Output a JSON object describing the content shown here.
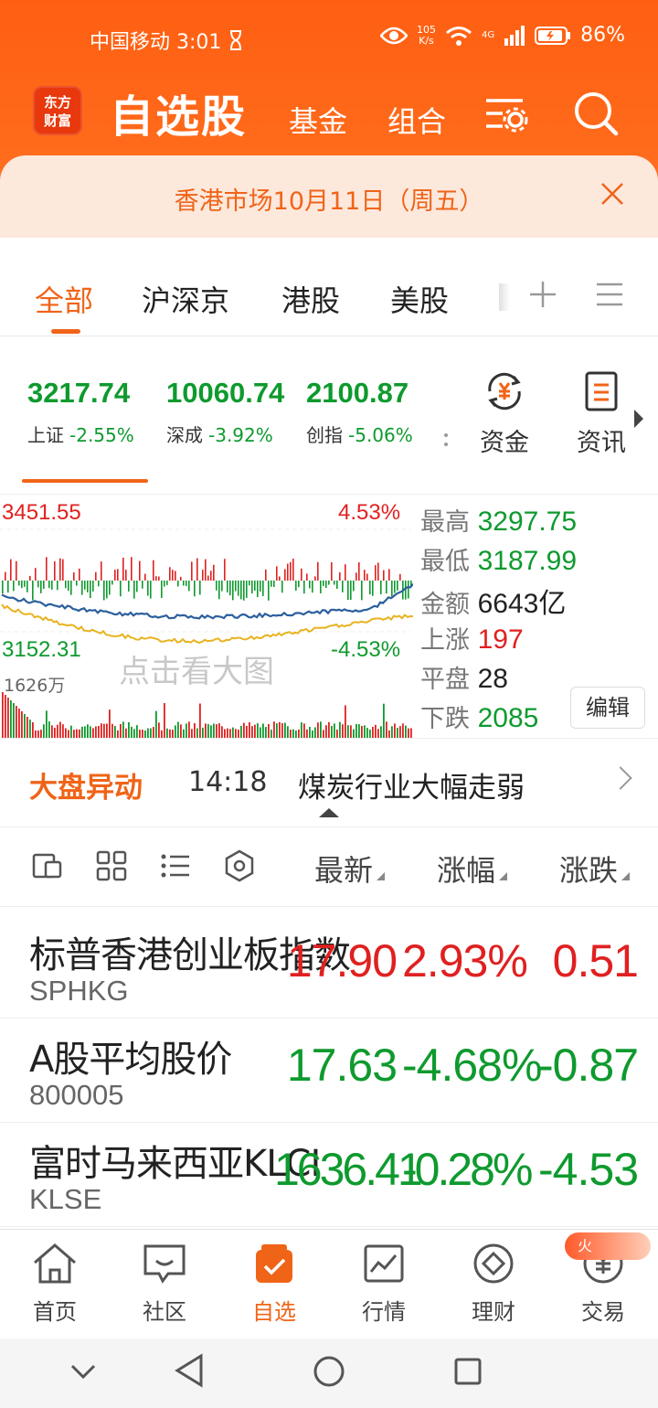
{
  "status_bar": {
    "carrier_time": "中国移动 3:01",
    "net_speed_top": "105",
    "net_speed_unit": "K/s",
    "signal_label": "4G",
    "battery": "86%"
  },
  "app_bar": {
    "logo_line1": "东方",
    "logo_line2": "财富",
    "title": "自选股",
    "tab_fund": "基金",
    "tab_combo": "组合"
  },
  "banner": {
    "text": "香港市场10月11日（周五）"
  },
  "tabs": [
    {
      "label": "全部"
    },
    {
      "label": "沪深京"
    },
    {
      "label": "港股"
    },
    {
      "label": "美股"
    }
  ],
  "indices": [
    {
      "value": "3217.74",
      "name": "上证",
      "change": "-2.55%"
    },
    {
      "value": "10060.74",
      "name": "深成",
      "change": "-3.92%"
    },
    {
      "value": "2100.87",
      "name": "创指",
      "change": "-5.06%"
    }
  ],
  "quick_links": [
    {
      "label": "资金",
      "icon": "yuan-cycle-icon"
    },
    {
      "label": "资讯",
      "icon": "document-icon"
    }
  ],
  "mini_chart": {
    "high_price": "3451.55",
    "high_pct": "4.53%",
    "low_price": "3152.31",
    "low_pct": "-4.53%",
    "volume": "1626万",
    "watermark": "点击看大图",
    "colors": {
      "up": "#e02020",
      "down": "#0e9a2e",
      "line_blue": "#2c5f9e",
      "line_yellow": "#e8b320"
    }
  },
  "market_stats": {
    "high_label": "最高",
    "high_value": "3297.75",
    "low_label": "最低",
    "low_value": "3187.99",
    "amount_label": "金额",
    "amount_value": "6643亿",
    "up_label": "上涨",
    "up_value": "197",
    "flat_label": "平盘",
    "flat_value": "28",
    "down_label": "下跌",
    "down_value": "2085",
    "edit_label": "编辑"
  },
  "market_alert": {
    "title": "大盘异动",
    "time": "14:18",
    "text": "煤炭行业大幅走弱"
  },
  "list_header": {
    "col_latest": "最新",
    "col_pct": "涨幅",
    "col_change": "涨跌"
  },
  "stocks": [
    {
      "name": "标普香港创业板指数",
      "code": "SPHKG",
      "latest": "17.90",
      "pct": "2.93%",
      "change": "0.51",
      "color": "#e02020"
    },
    {
      "name": "A股平均股价",
      "code": "800005",
      "latest": "17.63",
      "pct": "-4.68%",
      "change": "-0.87",
      "color": "#0e9a2e"
    },
    {
      "name": "富时马来西亚KLCI",
      "code": "KLSE",
      "latest": "1636.41",
      "pct": "-0.28%",
      "change": "-4.53",
      "color": "#0e9a2e"
    }
  ],
  "bottom_nav": [
    {
      "label": "首页",
      "icon": "home-icon"
    },
    {
      "label": "社区",
      "icon": "chat-icon"
    },
    {
      "label": "自选",
      "icon": "watchlist-check-icon"
    },
    {
      "label": "行情",
      "icon": "trend-chart-icon"
    },
    {
      "label": "理财",
      "icon": "diamond-icon"
    },
    {
      "label": "交易",
      "icon": "yuan-circle-icon"
    }
  ],
  "fire_badge": "火",
  "theme": {
    "accent": "#f06418",
    "header": "#ff6417"
  }
}
